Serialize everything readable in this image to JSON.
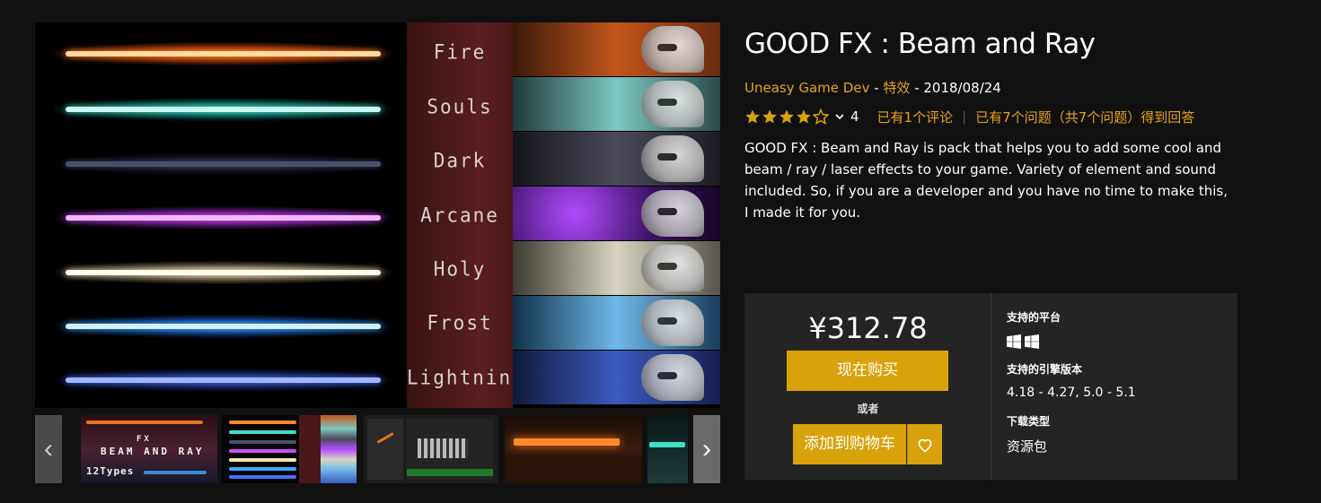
{
  "gallery": {
    "effects": [
      "Fire",
      "Souls",
      "Dark",
      "Arcane",
      "Holy",
      "Frost",
      "Lightning"
    ],
    "thumb_text": {
      "brand": "FX",
      "line1": "BEAM AND RAY",
      "line2": "12Types"
    },
    "prev_icon": "‹",
    "next_icon": "›"
  },
  "product": {
    "title": "GOOD FX : Beam and Ray",
    "publisher": "Uneasy Game Dev",
    "sep1": " - ",
    "category": "特效",
    "sep2": " - ",
    "date": "2018/08/24",
    "rating_value": 4,
    "rating_count": "4",
    "reviews_link": "已有1个评论",
    "divider": "|",
    "questions_link": "已有7个问题（共7个问题）得到回答",
    "description": "GOOD FX : Beam and Ray is pack that helps you to add some cool and beam / ray / laser effects to your game. Variety of element and sound included. So, if you are a developer and you have no time to make this, I made it for you."
  },
  "purchase": {
    "price": "¥312.78",
    "buy_now": "现在购买",
    "or": "或者",
    "add_to_cart": "添加到购物车",
    "platforms_heading": "支持的平台",
    "engine_heading": "支持的引擎版本",
    "engine_versions": "4.18 - 4.27, 5.0 - 5.1",
    "download_heading": "下载类型",
    "download_type": "资源包"
  },
  "colors": {
    "accent": "#e8a317",
    "button": "#daa20a",
    "panel": "#242424",
    "background": "#111111",
    "star": "#daa20a"
  }
}
